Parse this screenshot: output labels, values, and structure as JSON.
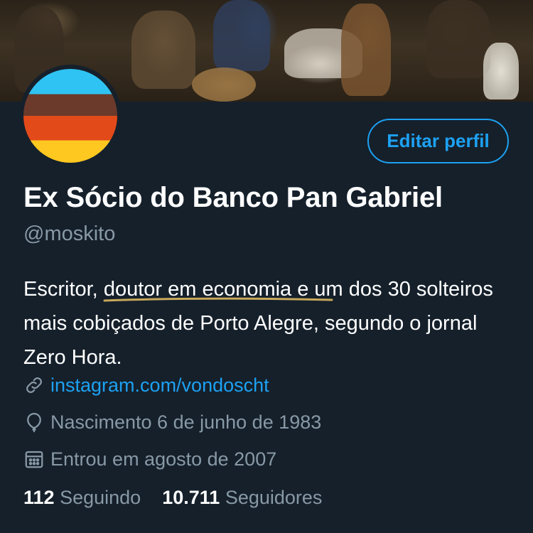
{
  "profile": {
    "display_name": "Ex Sócio do Banco Pan Gabriel",
    "handle": "@moskito",
    "edit_button": "Editar perfil",
    "bio": {
      "part1": "Escritor, ",
      "highlight": "doutor em economia",
      "part2": " e um dos 30 solteiros mais cobiçados de Porto Alegre, segundo o jornal Zero Hora."
    },
    "link": "instagram.com/vondoscht",
    "birth": "Nascimento 6 de junho de 1983",
    "joined": "Entrou em agosto de 2007",
    "following_count": "112",
    "following_label": "Seguindo",
    "followers_count": "10.711",
    "followers_label": "Seguidores"
  },
  "icons": {
    "link": "link-icon",
    "birth": "balloon-icon",
    "joined": "calendar-icon"
  },
  "colors": {
    "background": "#15202b",
    "accent": "#1da1f2",
    "secondary_text": "#8899a6",
    "highlight_underline": "#c8a85a"
  }
}
